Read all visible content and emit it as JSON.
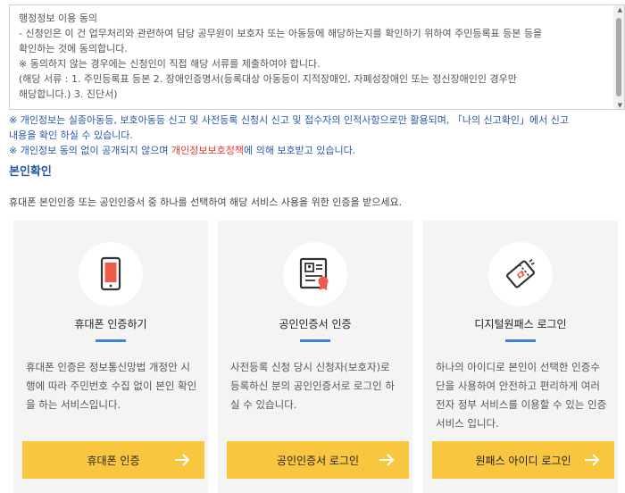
{
  "consent": {
    "lines": [
      "행정정보 이용 동의",
      "- 신청인은 이 건 업무처리와 관련하여 담당 공무원이 보호자 또는 아동등에 해당하는지를 확인하기 위하여 주민등록표 등본 등을",
      "확인하는 것에 동의합니다.",
      "※ 동의하지 않는 경우에는 신청인이 직접 해당 서류를 제출하여야 합니다.",
      "(해당 서류 : 1. 주민등록표 등본 2. 장애인증명서(등록대상 아동등이 지적장애인, 자폐성장애인 또는 정신장애인인 경우만",
      "해당합니다.) 3. 진단서)"
    ]
  },
  "privacy": {
    "line1": "※ 개인정보는 실종아동등, 보호아동등 신고 및 사전등록 신청시 신고 및 접수자의 인적사항으로만 활용되며, 「나의 신고확인」에서 신고",
    "line2": "내용을 확인 하실 수 있습니다.",
    "line3_prefix": "※ 개인정보 동의 없이 공개되지 않으며 ",
    "line3_link": "개인정보보호정책",
    "line3_suffix": "에 의해 보호받고 있습니다."
  },
  "section": {
    "title": "본인확인",
    "description": "휴대폰 본인인증 또는 공인인증서 중 하나를 선택하여 해당 서비스 사용을 위한 인증을 받으세요."
  },
  "cards": [
    {
      "title": "휴대폰 인증하기",
      "description": "휴대폰 인증은 정보통신망법 개정안 시행에 따라 주민번호 수집 없이 본인 확인을 하는 서비스입니다.",
      "button": "휴대폰 인증",
      "icon": "mobile-phone-icon"
    },
    {
      "title": "공인인증서 인증",
      "description": "사전등록 신청 당시 신청자(보호자)로 등록하신 분의 공인인증서로 로그인 하실 수 있습니다.",
      "button": "공인인증서 로그인",
      "icon": "certificate-icon"
    },
    {
      "title": "디지털원패스 로그인",
      "description": "하나의 아이디로 본인이 선택한 인증수단을 사용하여 안전하고 편리하게 여러 전자 정부 서비스를 이용할 수 있는 인증 서비스 입니다.",
      "button": "원패스 아이디 로그인",
      "icon": "onepass-ticket-icon"
    }
  ],
  "colors": {
    "accent_blue": "#2a57a8",
    "link_red": "#e63a2e",
    "button_yellow": "#f9c63f",
    "bar_blue": "#3d83dc",
    "icon_red": "#f05a4a"
  }
}
